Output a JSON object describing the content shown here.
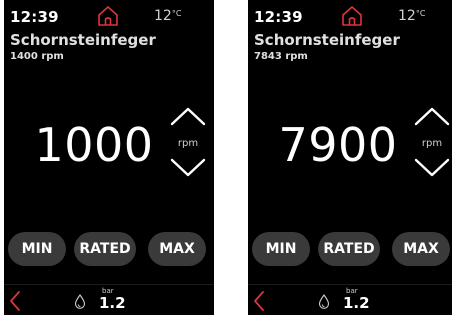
{
  "colors": {
    "background": "#000000",
    "accent_red": "#d9363e",
    "button_bg": "#3a3a3a",
    "text": "#ffffff"
  },
  "screens": [
    {
      "time": "12:39",
      "temperature": "12",
      "temperature_unit": "°C",
      "title": "Schornsteinfeger",
      "subtitle": "1400 rpm",
      "setpoint": "1000",
      "unit": "rpm",
      "buttons": {
        "min": "MIN",
        "rated": "RATED",
        "max": "MAX"
      },
      "pressure_unit": "bar",
      "pressure": "1.2",
      "icons": [
        "home-icon",
        "chevron-up-icon",
        "chevron-down-icon",
        "back-icon",
        "drop-icon"
      ]
    },
    {
      "time": "12:39",
      "temperature": "12",
      "temperature_unit": "°C",
      "title": "Schornsteinfeger",
      "subtitle": "7843 rpm",
      "setpoint": "7900",
      "unit": "rpm",
      "buttons": {
        "min": "MIN",
        "rated": "RATED",
        "max": "MAX"
      },
      "pressure_unit": "bar",
      "pressure": "1.2",
      "icons": [
        "home-icon",
        "chevron-up-icon",
        "chevron-down-icon",
        "back-icon",
        "drop-icon"
      ]
    }
  ]
}
